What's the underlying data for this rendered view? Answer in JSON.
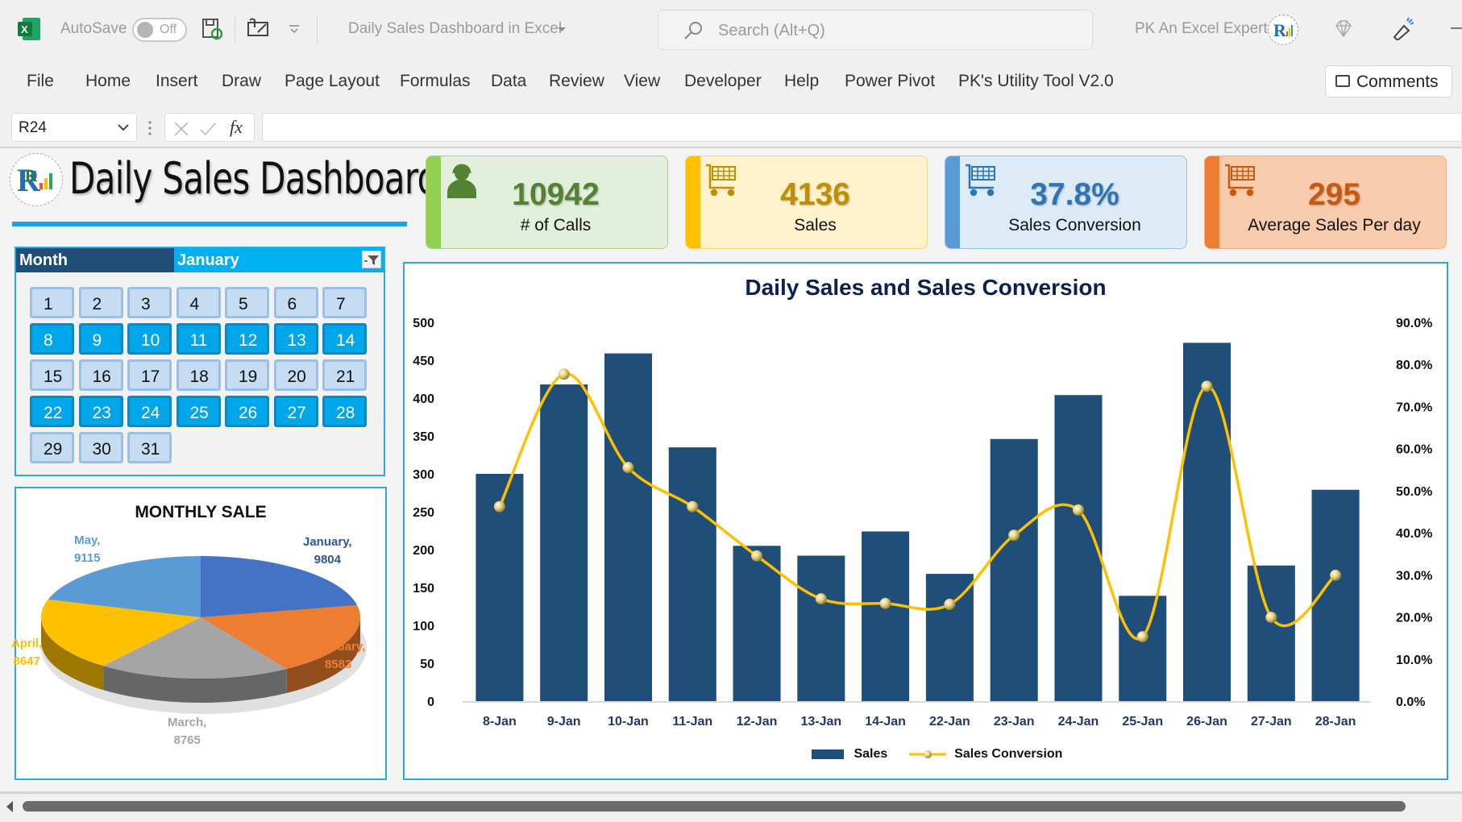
{
  "titlebar": {
    "autosave_label": "AutoSave",
    "autosave_state": "Off",
    "doc_title": "Daily Sales Dashboard in Excel",
    "search_placeholder": "Search (Alt+Q)",
    "user_name": "PK An Excel Expert"
  },
  "ribbon": {
    "tabs": [
      "File",
      "Home",
      "Insert",
      "Draw",
      "Page Layout",
      "Formulas",
      "Data",
      "Review",
      "View",
      "Developer",
      "Help",
      "Power Pivot",
      "PK's Utility Tool V2.0"
    ],
    "comments_label": "Comments"
  },
  "formula_bar": {
    "name_box": "R24",
    "fx_label": "fx",
    "formula": ""
  },
  "dashboard": {
    "title": "Daily Sales Dashboard",
    "kpis": [
      {
        "value": "10942",
        "label": "# of Calls",
        "icon": "call-center-agent-icon",
        "accent": "#92d050",
        "bg": "#e2efda",
        "border": "#a9d08e",
        "value_color": "#548235"
      },
      {
        "value": "4136",
        "label": "Sales",
        "icon": "shopping-cart-icon",
        "accent": "#ffc000",
        "bg": "#fff2cc",
        "border": "#ffd966",
        "value_color": "#bf8f00"
      },
      {
        "value": "37.8%",
        "label": "Sales Conversion",
        "icon": "shopping-cart-icon",
        "accent": "#5b9bd5",
        "bg": "#ddebf7",
        "border": "#9bc2e6",
        "value_color": "#2e75b6"
      },
      {
        "value": "295",
        "label": "Average Sales Per day",
        "icon": "shopping-cart-icon",
        "accent": "#ed7d31",
        "bg": "#f8cbad",
        "border": "#f4b084",
        "value_color": "#c55a11"
      }
    ],
    "slicer": {
      "header_label": "Month",
      "selected_month": "January",
      "days": [
        {
          "d": "1",
          "sel": false
        },
        {
          "d": "2",
          "sel": false
        },
        {
          "d": "3",
          "sel": false
        },
        {
          "d": "4",
          "sel": false
        },
        {
          "d": "5",
          "sel": false
        },
        {
          "d": "6",
          "sel": false
        },
        {
          "d": "7",
          "sel": false
        },
        {
          "d": "8",
          "sel": true
        },
        {
          "d": "9",
          "sel": true
        },
        {
          "d": "10",
          "sel": true
        },
        {
          "d": "11",
          "sel": true
        },
        {
          "d": "12",
          "sel": true
        },
        {
          "d": "13",
          "sel": true
        },
        {
          "d": "14",
          "sel": true
        },
        {
          "d": "15",
          "sel": false
        },
        {
          "d": "16",
          "sel": false
        },
        {
          "d": "17",
          "sel": false
        },
        {
          "d": "18",
          "sel": false
        },
        {
          "d": "19",
          "sel": false
        },
        {
          "d": "20",
          "sel": false
        },
        {
          "d": "21",
          "sel": false
        },
        {
          "d": "22",
          "sel": true
        },
        {
          "d": "23",
          "sel": true
        },
        {
          "d": "24",
          "sel": true
        },
        {
          "d": "25",
          "sel": true
        },
        {
          "d": "26",
          "sel": true
        },
        {
          "d": "27",
          "sel": true
        },
        {
          "d": "28",
          "sel": true
        },
        {
          "d": "29",
          "sel": false
        },
        {
          "d": "30",
          "sel": false
        },
        {
          "d": "31",
          "sel": false
        }
      ]
    }
  },
  "chart_data": [
    {
      "type": "pie",
      "title": "MONTHLY SALE",
      "categories": [
        "January",
        "February",
        "March",
        "April",
        "May"
      ],
      "values": [
        9804,
        8583,
        8765,
        8647,
        9115
      ],
      "labels": [
        "January,",
        "February,",
        "March,",
        "April,",
        "May,"
      ],
      "colors": [
        "#4472c4",
        "#ed7d31",
        "#a5a5a5",
        "#ffc000",
        "#5b9bd5"
      ],
      "label_colors": [
        "#2f5597",
        "#ed7d31",
        "#a5a5a5",
        "#ffc000",
        "#5b9bd5"
      ],
      "style": "3d"
    },
    {
      "type": "bar",
      "title": "Daily Sales and Sales Conversion",
      "categories": [
        "8-Jan",
        "9-Jan",
        "10-Jan",
        "11-Jan",
        "12-Jan",
        "13-Jan",
        "14-Jan",
        "22-Jan",
        "23-Jan",
        "24-Jan",
        "25-Jan",
        "26-Jan",
        "27-Jan",
        "28-Jan"
      ],
      "series": [
        {
          "name": "Sales",
          "type": "bar",
          "axis": "left",
          "color": "#1f4e79",
          "values": [
            300,
            418,
            459,
            335,
            205,
            192,
            224,
            168,
            346,
            404,
            139,
            473,
            179,
            279
          ]
        },
        {
          "name": "Sales Conversion",
          "type": "line",
          "axis": "right",
          "color": "#ffc000",
          "smooth": true,
          "values": [
            0.462,
            0.777,
            0.555,
            0.462,
            0.345,
            0.243,
            0.232,
            0.23,
            0.394,
            0.454,
            0.153,
            0.748,
            0.199,
            0.299
          ]
        }
      ],
      "y_left": {
        "min": 0,
        "max": 500,
        "ticks": [
          "0",
          "50",
          "100",
          "150",
          "200",
          "250",
          "300",
          "350",
          "400",
          "450",
          "500"
        ]
      },
      "y_right": {
        "min": 0,
        "max": 0.9,
        "ticks": [
          "0.0%",
          "10.0%",
          "20.0%",
          "30.0%",
          "40.0%",
          "50.0%",
          "60.0%",
          "70.0%",
          "80.0%",
          "90.0%"
        ]
      },
      "legend": {
        "position": "bottom",
        "items": [
          "Sales",
          "Sales Conversion"
        ]
      },
      "grid": false
    }
  ]
}
